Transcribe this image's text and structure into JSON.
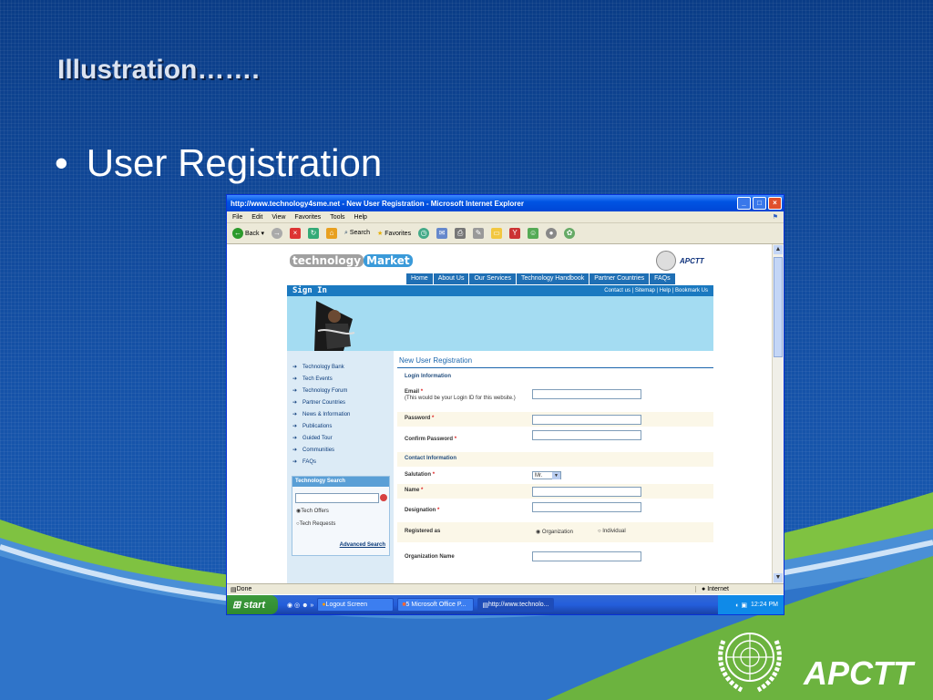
{
  "slide": {
    "title": "Illustration…….",
    "bullet": "User Registration",
    "footer_brand": "APCTT"
  },
  "browser": {
    "title": "http://www.technology4sme.net - New User Registration - Microsoft Internet Explorer",
    "menu": [
      "File",
      "Edit",
      "View",
      "Favorites",
      "Tools",
      "Help"
    ],
    "toolbar": {
      "back": "Back",
      "search": "Search",
      "favorites": "Favorites"
    },
    "status_left": "Done",
    "status_zone": "Internet"
  },
  "taskbar": {
    "start": "start",
    "buttons": [
      "Logout Screen",
      "5 Microsoft Office P...",
      "http://www.technolo..."
    ],
    "clock": "12:24 PM"
  },
  "site": {
    "logo_part1": "technology",
    "logo_part2": "Market",
    "brand": "APCTT",
    "top_nav": [
      "Home",
      "About Us",
      "Our Services",
      "Technology Handbook",
      "Partner Countries",
      "FAQs"
    ],
    "sign_in": "Sign In",
    "util_links": "Contact us  |  Sitemap  |  Help  |  Bookmark Us",
    "left_nav": [
      "Technology Bank",
      "Tech Events",
      "Technology Forum",
      "Partner Countries",
      "News & Information",
      "Publications",
      "Guided Tour",
      "Communities",
      "FAQs"
    ],
    "tech_search": {
      "title": "Technology Search",
      "opt1": "Tech Offers",
      "opt2": "Tech Requests",
      "advanced": "Advanced Search"
    }
  },
  "form": {
    "title": "New User Registration",
    "login_section": "Login Information",
    "email_label": "Email",
    "email_hint": "(This would be your Login ID for this website.)",
    "password_label": "Password",
    "confirm_label": "Confirm Password",
    "contact_section": "Contact Information",
    "salutation_label": "Salutation",
    "salutation_value": "Mr.",
    "name_label": "Name",
    "designation_label": "Designation",
    "registered_label": "Registered as",
    "reg_opt1": "Organization",
    "reg_opt2": "Individual",
    "org_name_label": "Organization Name"
  }
}
